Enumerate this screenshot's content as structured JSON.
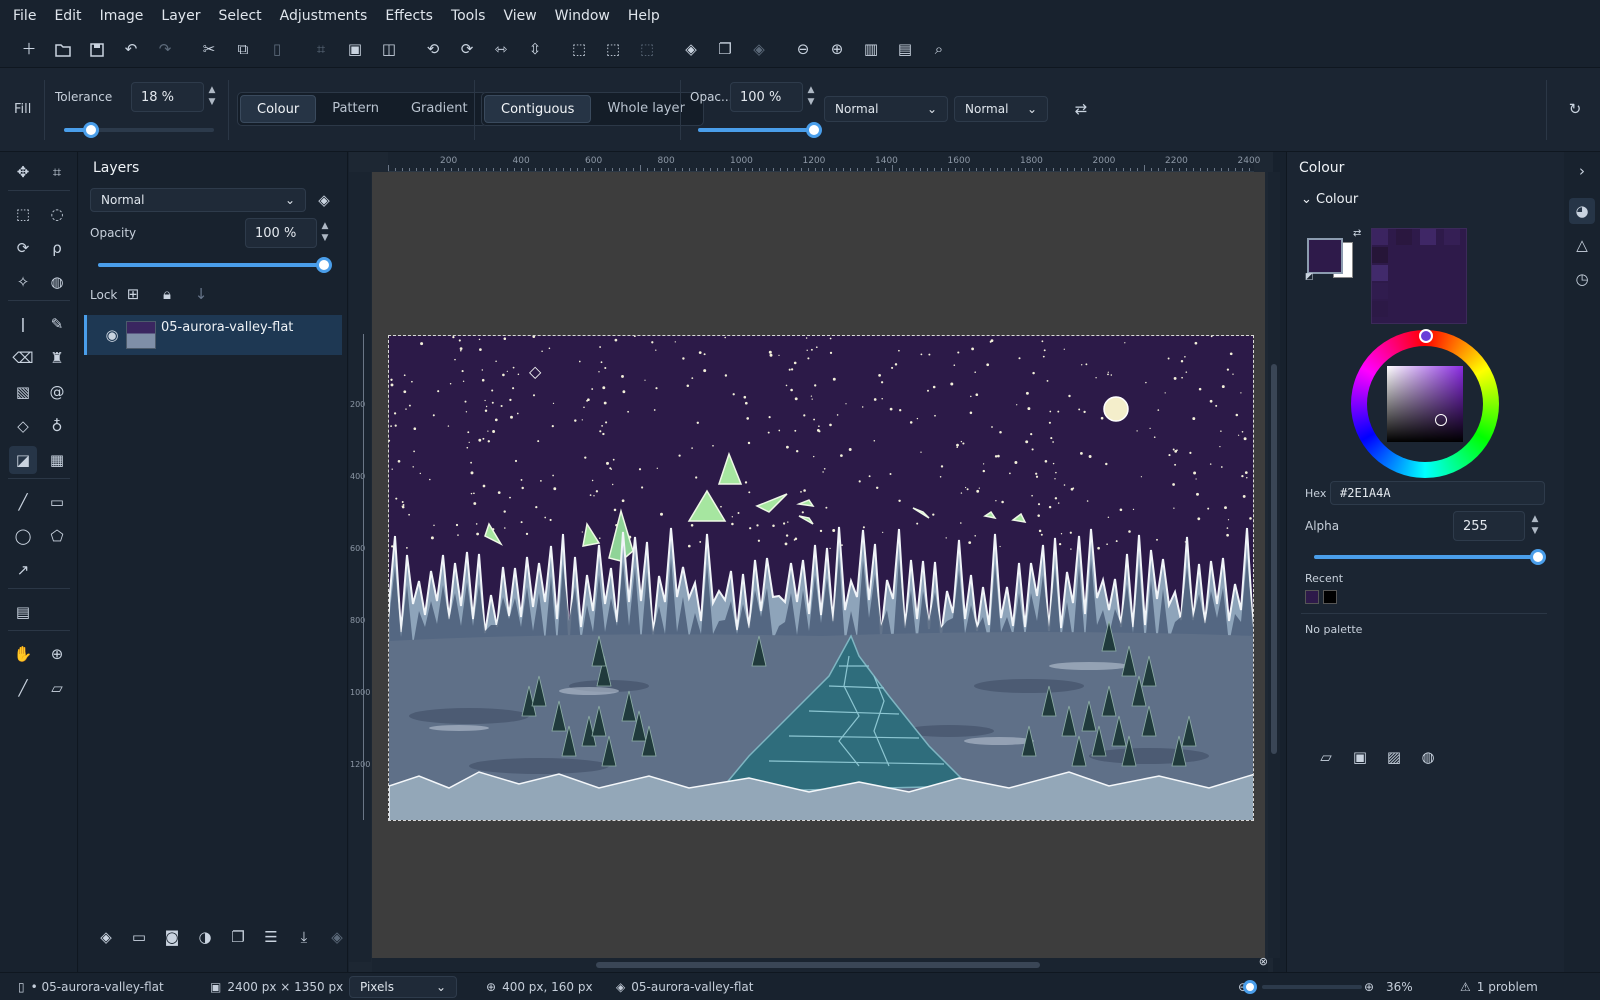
{
  "menu": [
    "File",
    "Edit",
    "Image",
    "Layer",
    "Select",
    "Adjustments",
    "Effects",
    "Tools",
    "View",
    "Window",
    "Help"
  ],
  "tool_options": {
    "tool_name": "Fill",
    "tolerance_label": "Tolerance",
    "tolerance_value": "18 %",
    "tolerance_fraction": 0.18,
    "fill_modes": [
      "Colour",
      "Pattern",
      "Gradient"
    ],
    "fill_mode_selected": "Colour",
    "flood_modes": [
      "Contiguous",
      "Whole layer"
    ],
    "flood_mode_selected": "Contiguous",
    "opacity_label": "Opac...",
    "opacity_value": "100 %",
    "opacity_fraction": 1.0,
    "blend_mode_1": "Normal",
    "blend_mode_2": "Normal"
  },
  "layers_panel": {
    "title": "Layers",
    "blend_mode": "Normal",
    "opacity_label": "Opacity",
    "opacity_value": "100 %",
    "opacity_fraction": 1.0,
    "lock_label": "Lock",
    "layers": [
      {
        "name": "05-aurora-valley-flat",
        "visible": true,
        "selected": true
      }
    ]
  },
  "ruler": {
    "top_ticks": [
      "200",
      "400",
      "600",
      "800",
      "1000",
      "1200",
      "1400",
      "1600",
      "1800",
      "2000",
      "2200",
      "2400"
    ],
    "left_ticks": [
      "200",
      "400",
      "600",
      "800",
      "1000",
      "1200"
    ]
  },
  "colour_panel": {
    "title": "Colour",
    "section": "Colour",
    "primary_color": "#2E1A4A",
    "secondary_color": "#FFFFFF",
    "hex_label": "Hex",
    "hex_value": "#2E1A4A",
    "alpha_label": "Alpha",
    "alpha_value": "255",
    "alpha_fraction": 1.0,
    "recent_label": "Recent",
    "recent_colors": [
      "#2E1A4A",
      "#000000"
    ],
    "palette_text": "No palette"
  },
  "status": {
    "document": "• 05-aurora-valley-flat",
    "image_size": "2400 px × 1350 px",
    "units": "Pixels",
    "cursor_position": "400 px, 160 px",
    "layer": "05-aurora-valley-flat",
    "zoom": "36%",
    "zoom_fraction": 0.36,
    "problems": "1 problem"
  },
  "colors": {
    "accent": "#4a9eea",
    "sky": "#2c1a48",
    "snow": "#5a6a80",
    "ice": "#2f6d7c",
    "aurora": "#9be59a"
  }
}
